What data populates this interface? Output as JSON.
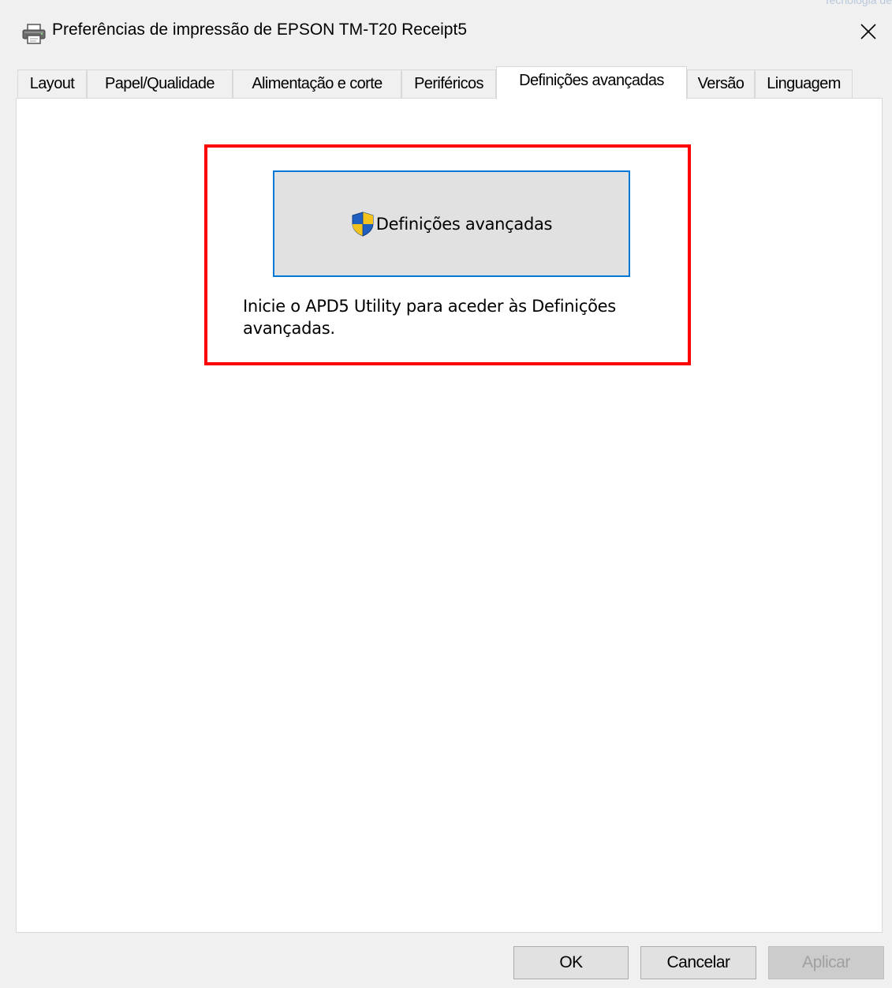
{
  "corner_text": "Tecnologia de",
  "window": {
    "title": "Preferências de impressão de EPSON TM-T20 Receipt5",
    "title_icon": "printer-icon",
    "close_icon": "close-icon"
  },
  "tabs": [
    {
      "label": "Layout",
      "active": false
    },
    {
      "label": "Papel/Qualidade",
      "active": false
    },
    {
      "label": "Alimentação e corte",
      "active": false
    },
    {
      "label": "Periféricos",
      "active": false
    },
    {
      "label": "Definições avançadas",
      "active": true
    },
    {
      "label": "Versão",
      "active": false
    },
    {
      "label": "Linguagem",
      "active": false
    }
  ],
  "panel": {
    "advanced_button_label": "Definições avançadas",
    "advanced_button_icon": "uac-shield-icon",
    "description": "Inicie o APD5 Utility para aceder às Definições avançadas."
  },
  "buttons": {
    "ok": "OK",
    "cancel": "Cancelar",
    "apply": "Aplicar"
  },
  "colors": {
    "highlight": "#ff0000",
    "focus_border": "#0078d7",
    "disabled_text": "#a0a0a0"
  }
}
